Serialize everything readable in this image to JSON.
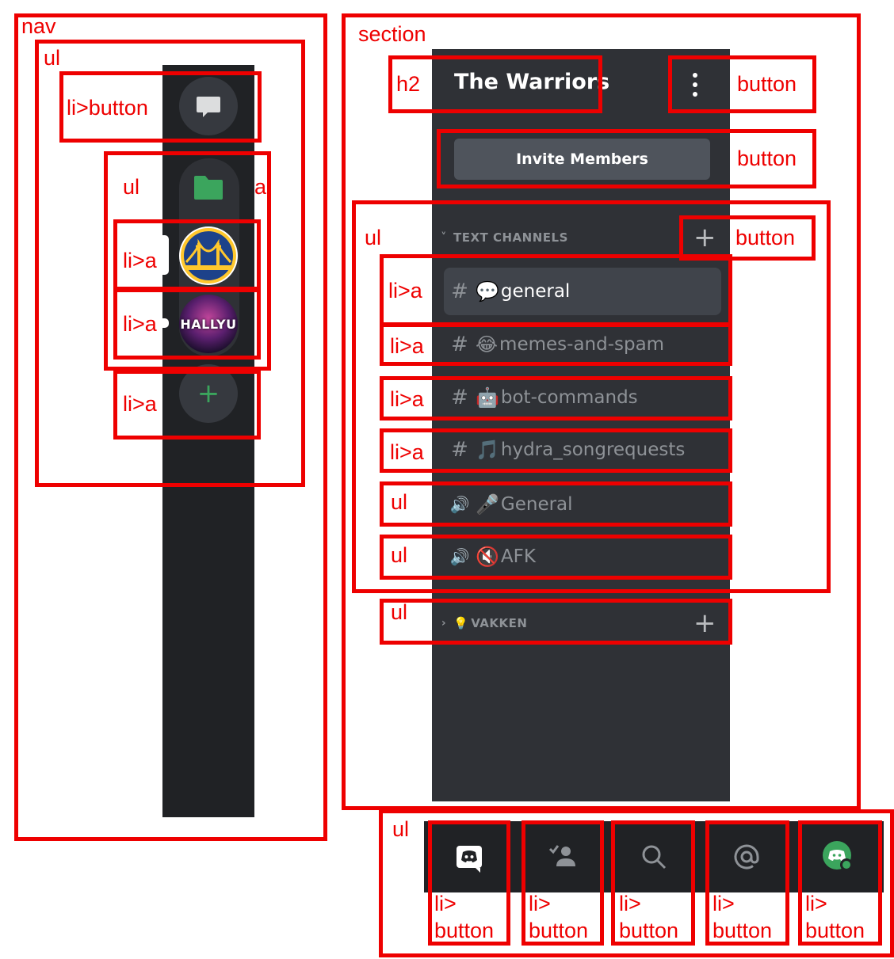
{
  "annotation_labels": {
    "nav": "nav",
    "ul": "ul",
    "li_button": "li>button",
    "li_a": "li>a",
    "a": "a",
    "section": "section",
    "h2": "h2",
    "button": "button",
    "li": "li>",
    "button_word": "button"
  },
  "rail": {
    "dm_icon": "chat-bubble-icon",
    "folder_icon": "folder-icon",
    "servers": [
      {
        "name": "Golden State Warriors",
        "icon": "warriors-bridge-logo"
      },
      {
        "name": "HALLYU",
        "icon_text": "HALLYU"
      }
    ],
    "add_icon": "+"
  },
  "server": {
    "title": "The Warriors",
    "menu_icon": "kebab-vertical-icon",
    "invite_label": "Invite Members"
  },
  "categories": [
    {
      "name": "TEXT CHANNELS",
      "collapsed": false,
      "chevron": "˅",
      "add": "+"
    },
    {
      "name": "VAKKEN",
      "emoji": "💡",
      "collapsed": true,
      "chevron": "›",
      "add": "+"
    }
  ],
  "channels": [
    {
      "type": "text",
      "prefix": "#",
      "emoji": "💬",
      "name": "general",
      "active": true
    },
    {
      "type": "text",
      "prefix": "#",
      "emoji": "😂",
      "name": "memes-and-spam",
      "active": false
    },
    {
      "type": "text",
      "prefix": "#",
      "emoji": "🤖",
      "name": "bot-commands",
      "active": false
    },
    {
      "type": "text",
      "prefix": "#",
      "emoji": "🎵",
      "name": "hydra_songrequests",
      "active": false
    },
    {
      "type": "voice",
      "prefix": "🔊",
      "emoji": "🎤",
      "name": "General",
      "active": false
    },
    {
      "type": "voice",
      "prefix": "🔊",
      "emoji": "🔇",
      "name": "AFK",
      "active": false
    }
  ],
  "tabs": [
    {
      "icon": "discord-home-icon",
      "active": true
    },
    {
      "icon": "friends-icon",
      "active": false
    },
    {
      "icon": "search-icon",
      "active": false
    },
    {
      "icon": "mentions-at-icon",
      "active": false
    },
    {
      "icon": "profile-avatar-icon",
      "active": false
    }
  ],
  "colors": {
    "annotation_red": "#ee0000",
    "rail_bg": "#202225",
    "panel_bg": "#2f3136",
    "active_channel_bg": "#40444b",
    "green_accent": "#3ba55d",
    "warriors_blue": "#1d428a",
    "warriors_gold": "#ffc72c"
  }
}
